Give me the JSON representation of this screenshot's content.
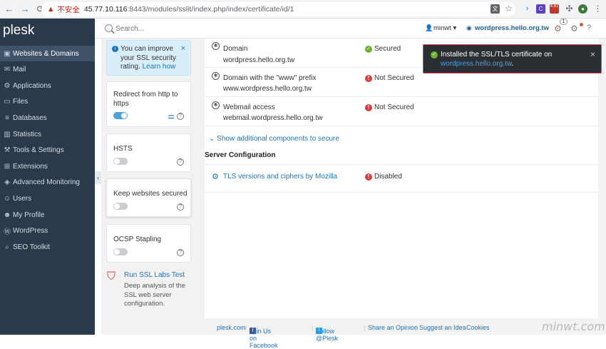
{
  "browser": {
    "insecure_label": "不安全",
    "url_host": "45.77.10.116",
    "url_path": ":8443/modules/sslit/index.php/index/certificate/id/1",
    "ext_badge": "4.61"
  },
  "sidebar": {
    "logo": "plesk",
    "items": [
      {
        "label": "Websites & Domains",
        "icon": "globe-icon"
      },
      {
        "label": "Mail",
        "icon": "mail-icon"
      },
      {
        "label": "Applications",
        "icon": "applications-icon"
      },
      {
        "label": "Files",
        "icon": "files-icon"
      },
      {
        "label": "Databases",
        "icon": "database-icon"
      },
      {
        "label": "Statistics",
        "icon": "statistics-icon"
      },
      {
        "label": "Tools & Settings",
        "icon": "tools-icon"
      },
      {
        "label": "Extensions",
        "icon": "extensions-icon"
      },
      {
        "label": "Advanced Monitoring",
        "icon": "monitoring-icon"
      },
      {
        "label": "Users",
        "icon": "users-icon"
      },
      {
        "label": "My Profile",
        "icon": "profile-icon"
      },
      {
        "label": "WordPress",
        "icon": "wordpress-icon"
      },
      {
        "label": "SEO Toolkit",
        "icon": "seo-icon"
      }
    ]
  },
  "header": {
    "search_placeholder": "Search...",
    "user": "minwt",
    "domain": "wordpress.hello.org.tw",
    "updates_badge": "1"
  },
  "leftcol": {
    "info_text": "You can improve your SSL security rating.",
    "info_link": "Learn how",
    "redirect_label": "Redirect from http to https",
    "redirect_on": true,
    "hsts_label": "HSTS",
    "keep_secured_label": "Keep websites secured",
    "ocsp_label": "OCSP Stapling",
    "ssl_test_link": "Run SSL Labs Test",
    "ssl_test_desc": "Deep analysis of the SSL web server configuration."
  },
  "components": [
    {
      "title": "Domain",
      "sub": "wordpress.hello.org.tw",
      "status": "Secured",
      "ok": true
    },
    {
      "title": "Domain with the \"www\" prefix",
      "sub": "www.wordpress.hello.org.tw",
      "status": "Not Secured",
      "ok": false
    },
    {
      "title": "Webmail access",
      "sub": "webmail.wordpress.hello.org.tw",
      "status": "Not Secured",
      "ok": false
    }
  ],
  "show_more": "Show additional components to secure",
  "server_config": {
    "heading": "Server Configuration",
    "item": "TLS versions and ciphers by Mozilla",
    "status": "Disabled"
  },
  "toast": {
    "text": "Installed the SSL/TLS certificate on",
    "link": "wordpress.hello.org.tw",
    "period": "."
  },
  "footer": [
    "plesk.com",
    "Join Us on Facebook",
    "Follow @Plesk",
    "Share an Opinion",
    "Suggest an Idea",
    "Cookies"
  ],
  "watermark": "minwt.com",
  "colors": {
    "sidebar": "#2b3a4a",
    "accent": "#1e74b8",
    "ok": "#6ab42d",
    "error": "#d83c3c"
  }
}
